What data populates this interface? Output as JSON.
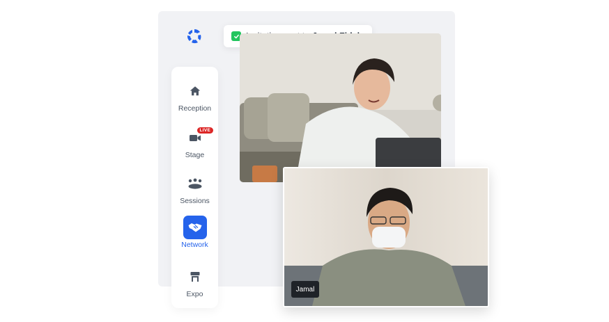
{
  "toast": {
    "message": "Invitation sent to",
    "recipient": "Jamal Fidalgo"
  },
  "nav": {
    "items": [
      {
        "label": "Reception",
        "icon": "home-icon"
      },
      {
        "label": "Stage",
        "icon": "video-camera-icon",
        "badge": "LIVE"
      },
      {
        "label": "Sessions",
        "icon": "people-group-icon"
      },
      {
        "label": "Network",
        "icon": "handshake-icon",
        "active": true
      },
      {
        "label": "Expo",
        "icon": "booth-icon"
      }
    ]
  },
  "videos": {
    "participant_name": "Jamal"
  },
  "colors": {
    "accent": "#2563eb",
    "live": "#dc2626",
    "success": "#22c55e",
    "panel": "#f1f2f5"
  }
}
